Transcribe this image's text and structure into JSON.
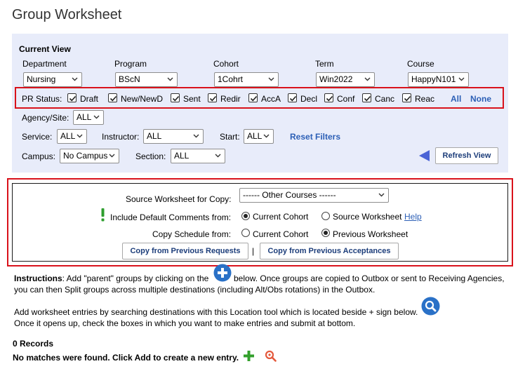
{
  "page": {
    "title": "Group Worksheet"
  },
  "filters": {
    "section_title": "Current View",
    "department": {
      "label": "Department",
      "value": "Nursing"
    },
    "program": {
      "label": "Program",
      "value": "BScN"
    },
    "cohort": {
      "label": "Cohort",
      "value": "1Cohrt"
    },
    "term": {
      "label": "Term",
      "value": "Win2022"
    },
    "course": {
      "label": "Course",
      "value": "HappyN101"
    },
    "pr_status": {
      "label": "PR Status:",
      "items": [
        {
          "label": "Draft",
          "checked": true
        },
        {
          "label": "New/NewD",
          "checked": true
        },
        {
          "label": "Sent",
          "checked": true
        },
        {
          "label": "Redir",
          "checked": true
        },
        {
          "label": "AccA",
          "checked": true
        },
        {
          "label": "Decl",
          "checked": true
        },
        {
          "label": "Conf",
          "checked": true
        },
        {
          "label": "Canc",
          "checked": true
        },
        {
          "label": "Reac",
          "checked": true
        }
      ],
      "all_link": "All",
      "none_link": "None"
    },
    "agency": {
      "label": "Agency/Site:",
      "value": "ALL"
    },
    "service": {
      "label": "Service:",
      "value": "ALL"
    },
    "instructor": {
      "label": "Instructor:",
      "value": "ALL"
    },
    "start": {
      "label": "Start:",
      "value": "ALL"
    },
    "reset_link": "Reset Filters",
    "campus": {
      "label": "Campus:",
      "value": "No Campus"
    },
    "section": {
      "label": "Section:",
      "value": "ALL"
    },
    "refresh_button": "Refresh View"
  },
  "copy": {
    "source_label": "Source Worksheet for Copy:",
    "source_value": "------ Other Courses ------",
    "comments_label": "Include Default Comments from:",
    "comments_options": [
      "Current Cohort",
      "Source Worksheet"
    ],
    "comments_selected": "Current Cohort",
    "help_link": "Help",
    "schedule_label": "Copy Schedule from:",
    "schedule_options": [
      "Current Cohort",
      "Previous Worksheet"
    ],
    "schedule_selected": "Previous Worksheet",
    "btn_requests": "Copy from Previous Requests",
    "separator": "|",
    "btn_acceptances": "Copy from Previous Acceptances"
  },
  "instructions": {
    "bold_label": "Instructions",
    "line1_a": ":  Add \"parent\" groups by clicking on the",
    "line1_b": "below. Once groups are copied to Outbox or sent to Receiving Agencies,",
    "line2": "you can then Split groups across multiple destinations (including Alt/Obs rotations) in the Outbox.",
    "line3": "Add worksheet entries by searching destinations with this Location tool which is located beside + sign below.",
    "line4": "Once it opens up, check the boxes in which you want to make entries and submit at bottom."
  },
  "records": {
    "count_text": "0 Records",
    "empty_text": "No matches were found. Click Add to create a new entry."
  },
  "colors": {
    "panel_bg": "#e8ecfa",
    "highlight_red": "#d9121b",
    "link_blue": "#2c5fb6",
    "icon_blue": "#2a71c7",
    "add_green": "#33a02c",
    "search_orange": "#e4593c",
    "warning_green": "#2e9e2e"
  }
}
